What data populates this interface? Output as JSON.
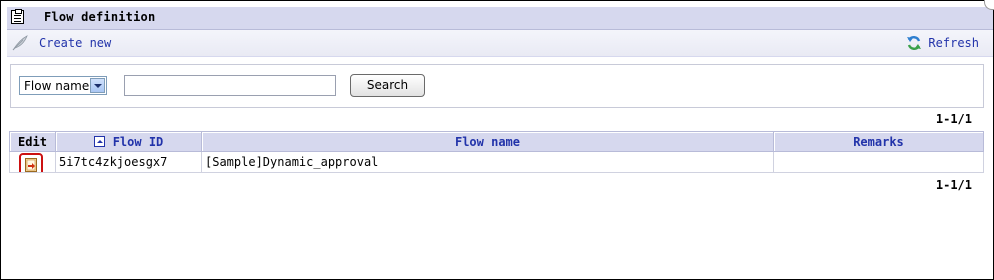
{
  "header": {
    "title": "Flow definition"
  },
  "toolbar": {
    "create_label": "Create new",
    "refresh_label": "Refresh"
  },
  "search": {
    "field_selected": "Flow name",
    "query_value": "",
    "button_label": "Search"
  },
  "pager": {
    "top": "1-1/1",
    "bottom": "1-1/1"
  },
  "table": {
    "columns": [
      "Edit",
      "Flow ID",
      "Flow name",
      "Remarks"
    ],
    "rows": [
      {
        "flow_id": "5i7tc4zkjoesgx7",
        "flow_name": "[Sample]Dynamic_approval",
        "remarks": ""
      }
    ]
  },
  "colors": {
    "header_bg": "#d6d8ee",
    "link": "#2233aa",
    "highlight": "#cc1111"
  }
}
